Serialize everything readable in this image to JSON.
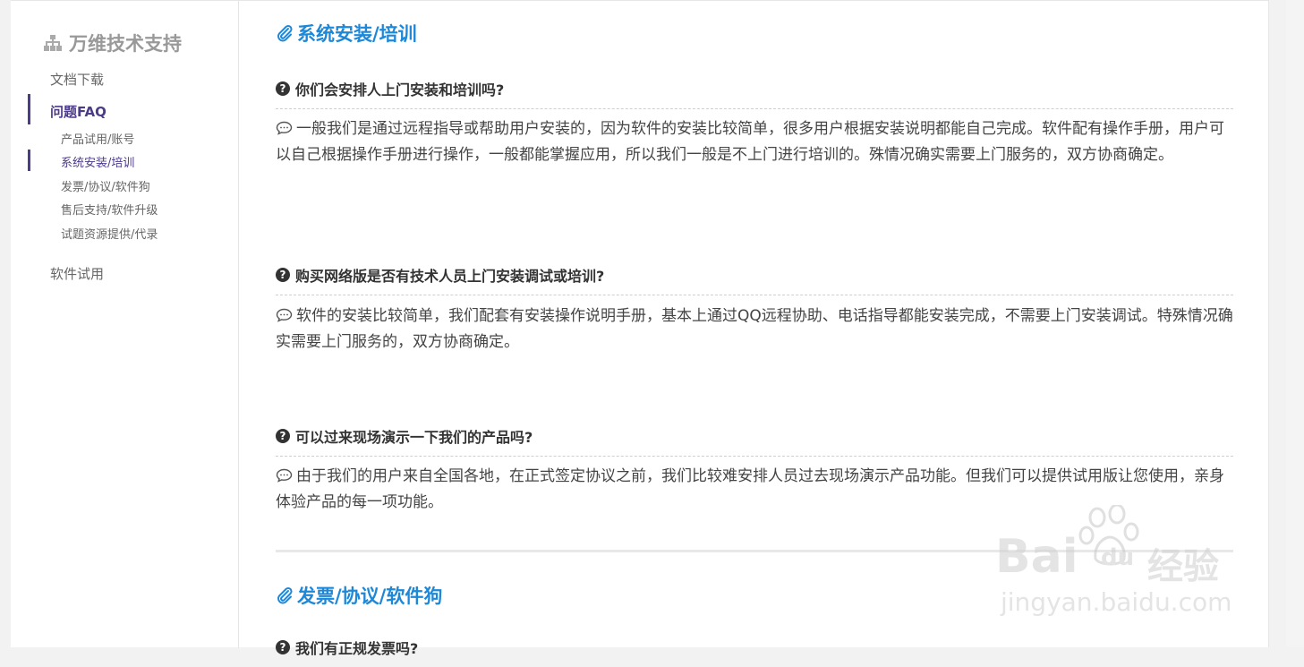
{
  "sidebar": {
    "brand": "万维技术支持",
    "items": [
      {
        "label": "文档下载"
      },
      {
        "label": "问题FAQ"
      },
      {
        "label": "软件试用"
      }
    ],
    "faq_subitems": [
      {
        "label": "产品试用/账号"
      },
      {
        "label": "系统安装/培训"
      },
      {
        "label": "发票/协议/软件狗"
      },
      {
        "label": "售后支持/软件升级"
      },
      {
        "label": "试题资源提供/代录"
      }
    ]
  },
  "content": {
    "section1_title": "系统安装/培训",
    "questions": [
      {
        "q": "你们会安排人上门安装和培训吗?",
        "a": "一般我们是通过远程指导或帮助用户安装的，因为软件的安装比较简单，很多用户根据安装说明都能自己完成。软件配有操作手册，用户可以自己根据操作手册进行操作，一般都能掌握应用，所以我们一般是不上门进行培训的。殊情况确实需要上门服务的，双方协商确定。"
      },
      {
        "q": "购买网络版是否有技术人员上门安装调试或培训?",
        "a": "软件的安装比较简单，我们配套有安装操作说明手册，基本上通过QQ远程协助、电话指导都能安装完成，不需要上门安装调试。特殊情况确实需要上门服务的，双方协商确定。"
      },
      {
        "q": "可以过来现场演示一下我们的产品吗?",
        "a": "由于我们的用户来自全国各地，在正式签定协议之前，我们比较难安排人员过去现场演示产品功能。但我们可以提供试用版让您使用，亲身体验产品的每一项功能。"
      }
    ],
    "section2_title": "发票/协议/软件狗",
    "next_question": "我们有正规发票吗?"
  },
  "watermark": {
    "brand": "Bai",
    "du": "du",
    "jingyan": "经验",
    "url": "jingyan.baidu.com"
  },
  "colors": {
    "accent": "#1e88d8",
    "active": "#4c3a8a"
  }
}
